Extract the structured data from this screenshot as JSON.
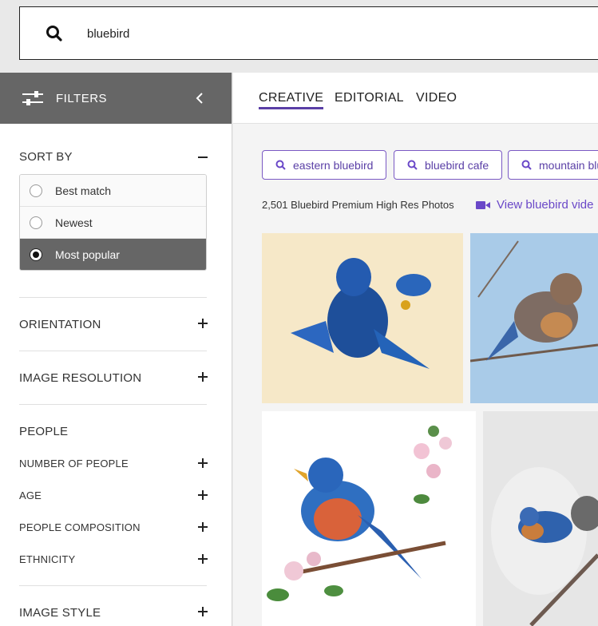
{
  "search": {
    "value": "bluebird",
    "placeholder": ""
  },
  "sidebar": {
    "filters_label": "FILTERS",
    "sort_by": {
      "heading": "SORT BY",
      "options": [
        {
          "label": "Best match",
          "selected": false
        },
        {
          "label": "Newest",
          "selected": false
        },
        {
          "label": "Most popular",
          "selected": true
        }
      ]
    },
    "sections": {
      "orientation": "ORIENTATION",
      "image_resolution": "IMAGE RESOLUTION",
      "people": "PEOPLE",
      "number_of_people": "NUMBER OF PEOPLE",
      "age": "AGE",
      "people_composition": "PEOPLE COMPOSITION",
      "ethnicity": "ETHNICITY",
      "image_style": "IMAGE STYLE"
    }
  },
  "tabs": [
    "CREATIVE",
    "EDITORIAL",
    "VIDEO"
  ],
  "chips": [
    "eastern bluebird",
    "bluebird cafe",
    "mountain blu"
  ],
  "results": {
    "count_text": "2,501 Bluebird Premium High Res Photos",
    "video_link": "View bluebird vide"
  },
  "colors": {
    "accent": "#5a3fa6",
    "sidebar_header": "#666666",
    "selected_option": "#666666"
  }
}
